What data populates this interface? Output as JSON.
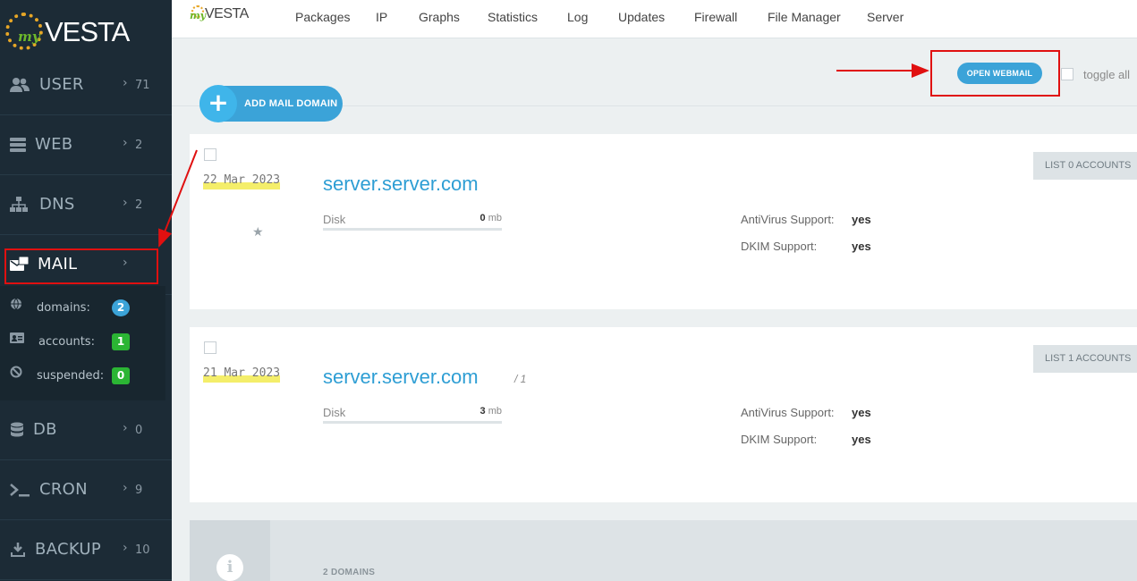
{
  "sidebar": {
    "logo_my": "my",
    "logo_brand": "VESTA",
    "items": [
      {
        "label": "USER",
        "count": "71",
        "icon": "users-icon"
      },
      {
        "label": "WEB",
        "count": "2",
        "icon": "server-icon"
      },
      {
        "label": "DNS",
        "count": "2",
        "icon": "sitemap-icon"
      },
      {
        "label": "MAIL",
        "count": "",
        "icon": "mail-icon"
      },
      {
        "label": "DB",
        "count": "0",
        "icon": "database-icon"
      },
      {
        "label": "CRON",
        "count": "9",
        "icon": "terminal-icon"
      },
      {
        "label": "BACKUP",
        "count": "10",
        "icon": "download-icon"
      }
    ],
    "mail_submenu": [
      {
        "label": "domains:",
        "value": "2",
        "icon": "globe-icon"
      },
      {
        "label": "accounts:",
        "value": "1",
        "icon": "id-card-icon"
      },
      {
        "label": "suspended:",
        "value": "0",
        "icon": "ban-icon"
      }
    ]
  },
  "topbar": {
    "logo_my": "my",
    "logo_brand": "VESTA",
    "menu": [
      "Packages",
      "IP",
      "Graphs",
      "Statistics",
      "Log",
      "Updates",
      "Firewall",
      "File Manager",
      "Server"
    ]
  },
  "toolbar": {
    "add_label": "ADD MAIL DOMAIN",
    "webmail_label": "OPEN WEBMAIL",
    "toggle_label": "toggle all"
  },
  "domains": [
    {
      "date": "22 Mar 2023",
      "name": "server.server.com",
      "suffix": "",
      "disk_label": "Disk",
      "disk_value": "0",
      "disk_unit": "mb",
      "disk_fraction": 0,
      "antivirus_label": "AntiVirus Support:",
      "antivirus_value": "yes",
      "dkim_label": "DKIM Support:",
      "dkim_value": "yes",
      "list_label": "LIST 0 ACCOUNTS"
    },
    {
      "date": "21 Mar 2023",
      "name": "server.server.com",
      "suffix": "/ 1",
      "disk_label": "Disk",
      "disk_value": "3",
      "disk_unit": "mb",
      "disk_fraction": 0,
      "antivirus_label": "AntiVirus Support:",
      "antivirus_value": "yes",
      "dkim_label": "DKIM Support:",
      "dkim_value": "yes",
      "list_label": "LIST 1 ACCOUNTS"
    }
  ],
  "summary": {
    "text": "2 DOMAINS"
  },
  "colors": {
    "accent": "#3ba3d8",
    "sidebar_bg": "#1c2b36",
    "annotation_red": "#e01010",
    "date_highlight": "#f4ee6a"
  }
}
